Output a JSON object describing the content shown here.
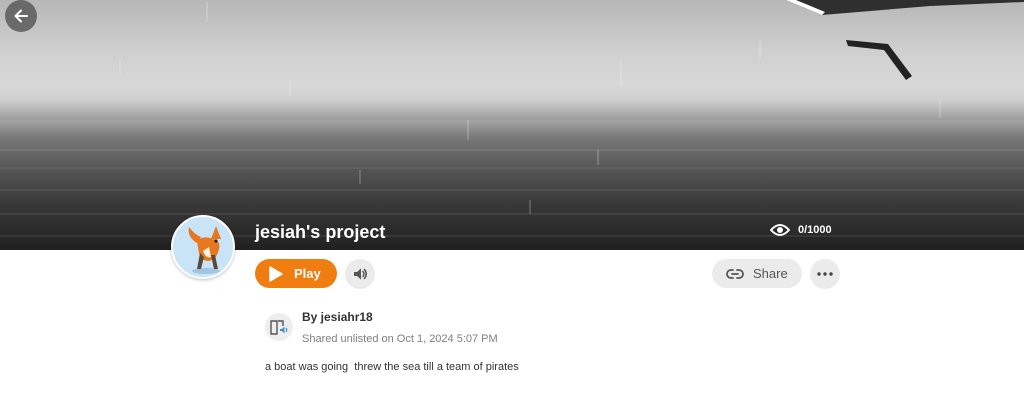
{
  "project": {
    "title": "jesiah's project",
    "views": "0/1000"
  },
  "actions": {
    "play_label": "Play",
    "share_label": "Share"
  },
  "author": {
    "byline": "By jesiahr18",
    "shared": "Shared unlisted on Oct 1, 2024 5:07 PM"
  },
  "description": "a boat was going  threw the sea till a team of pirates",
  "icons": {
    "back": "arrow-left-icon",
    "views": "eye-icon",
    "play": "play-icon",
    "sound": "speaker-icon",
    "share": "link-icon",
    "more": "more-icon",
    "author": "book-audio-icon"
  },
  "colors": {
    "accent": "#f07d0f",
    "button_bg": "#ebebeb"
  }
}
